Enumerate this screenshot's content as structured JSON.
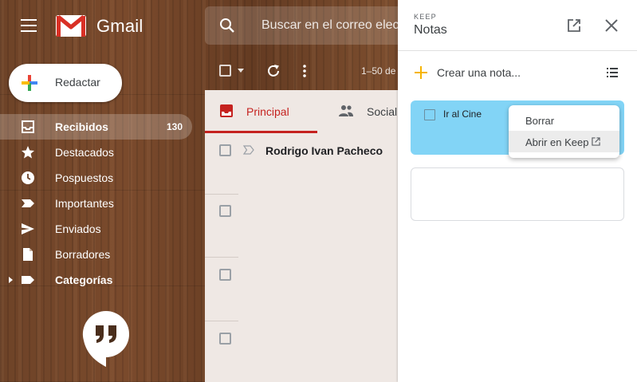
{
  "app": {
    "name": "Gmail"
  },
  "search": {
    "placeholder": "Buscar en el correo electrónico"
  },
  "compose": {
    "label": "Redactar"
  },
  "nav": {
    "items": [
      {
        "label": "Recibidos",
        "count": "130",
        "icon": "inbox-icon"
      },
      {
        "label": "Destacados",
        "icon": "star-icon"
      },
      {
        "label": "Pospuestos",
        "icon": "clock-icon"
      },
      {
        "label": "Importantes",
        "icon": "label-important-icon"
      },
      {
        "label": "Enviados",
        "icon": "send-icon"
      },
      {
        "label": "Borradores",
        "icon": "draft-icon"
      },
      {
        "label": "Categorías",
        "icon": "label-icon"
      }
    ]
  },
  "toolbar": {
    "range": "1–50 de"
  },
  "tabs": {
    "principal": "Principal",
    "social": "Social"
  },
  "mail_rows": [
    {
      "sender": "Rodrigo Ivan Pacheco"
    },
    {
      "sender": ""
    },
    {
      "sender": ""
    },
    {
      "sender": ""
    }
  ],
  "keep": {
    "brand": "KEEP",
    "title": "Notas",
    "new_note": "Crear una nota...",
    "note": {
      "text": "Ir al Cine",
      "color": "#82d4f6"
    },
    "menu": {
      "delete": "Borrar",
      "open_in_keep": "Abrir en Keep"
    }
  },
  "colors": {
    "accent_red": "#c5221f"
  }
}
